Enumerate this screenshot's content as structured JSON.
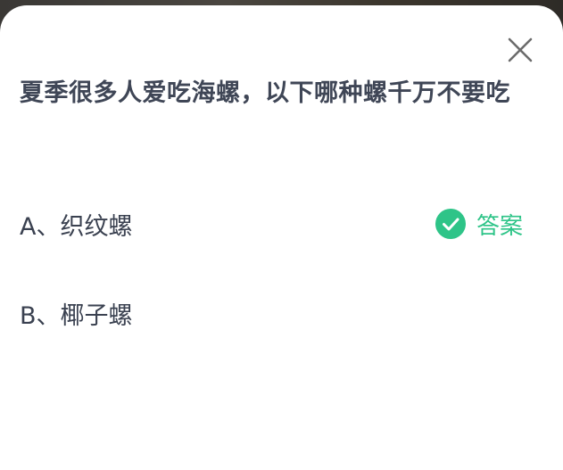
{
  "dialog": {
    "question": "夏季很多人爱吃海螺，以下哪种螺千万不要吃",
    "options": [
      {
        "letter": "A、",
        "text": "织纹螺",
        "is_answer": true
      },
      {
        "letter": "B、",
        "text": "椰子螺",
        "is_answer": false
      }
    ],
    "answer_label": "答案"
  },
  "icons": {
    "close": "close-icon",
    "answer": "check-circle-icon"
  },
  "colors": {
    "text": "#3a4150",
    "accent": "#2ec488",
    "close": "#6b6b6b"
  }
}
